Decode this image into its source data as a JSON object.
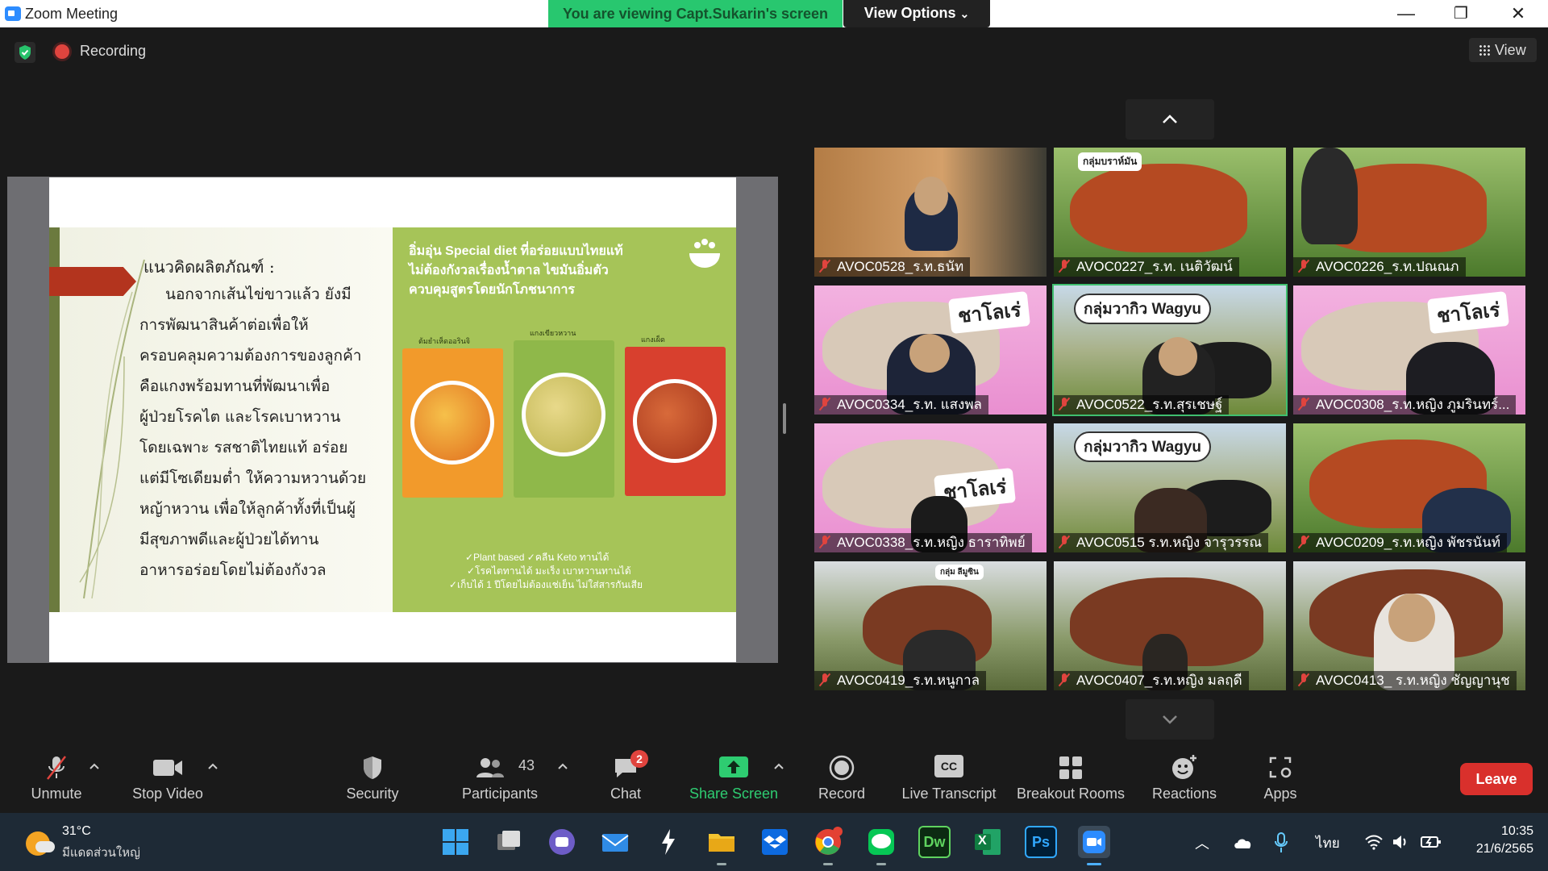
{
  "window": {
    "title": "Zoom Meeting",
    "viewing_banner": "You are viewing Capt.Sukarin's screen",
    "view_options": "View Options",
    "minimize": "—",
    "maximize": "❐",
    "close": "✕"
  },
  "status": {
    "recording_label": "Recording",
    "view_label": "View"
  },
  "slide": {
    "heading": "แนวคิดผลิตภัณฑ์ :",
    "body_lines": [
      "นอกจากเส้นไข่ขาวแล้ว ยังมี",
      "การพัฒนาสินค้าต่อเพื่อให้",
      "ครอบคลุมความต้องการของลูกค้า",
      "คือแกงพร้อมทานที่พัฒนาเพื่อ",
      "ผู้ป่วยโรคไต และโรคเบาหวาน",
      "โดยเฉพาะ รสชาติไทยแท้ อร่อย",
      "แต่มีโซเดียมต่ำ ให้ความหวานด้วย",
      "หญ้าหวาน เพื่อให้ลูกค้าทั้งที่เป็นผู้",
      "มีสุขภาพดีและผู้ป่วยได้ทาน",
      "อาหารอร่อยโดยไม่ต้องกังวล"
    ],
    "promo_title_1": "อิ่มอุ่น Special diet ที่อร่อยแบบไทยแท้",
    "promo_title_2": "ไม่ต้องกังวลเรื่องน้ำตาล ไขมันอิ่มตัว",
    "promo_title_3": "ควบคุมสูตรโดยนักโภชนาการ",
    "packs": [
      "ต้มยำเห็ดออรินจิ",
      "แกงเขียวหวาน",
      "แกงเผ็ด"
    ],
    "features": [
      "✓Plant based  ✓คลีน Keto ทานได้",
      "✓โรคไตทานได้ มะเร็ง เบาหวานทานได้",
      "✓เก็บได้ 1 ปีโดยไม่ต้องแช่เย็น ไม่ใส่สารกันเสีย"
    ]
  },
  "gallery": {
    "tiles": [
      {
        "name": "AVOC0528_ร.ท.ธนัท",
        "sign": ""
      },
      {
        "name": "AVOC0227_ร.ท. เนติวัฒน์",
        "sign": "กลุ่มบราห์มัน"
      },
      {
        "name": "AVOC0226_ร.ท.ปณณภ",
        "sign": ""
      },
      {
        "name": "AVOC0334_ร.ท. แสงพล",
        "sign": "ชาโลเร่"
      },
      {
        "name": "AVOC0522_ร.ท.สุรเชษฐ์",
        "sign": "กลุ่มวากิว Wagyu"
      },
      {
        "name": "AVOC0308_ร.ท.หญิง ภูมรินทร์...",
        "sign": "ชาโลเร่"
      },
      {
        "name": "AVOC0338_ร.ท.หญิง ธาราทิพย์",
        "sign": "ชาโลเร่"
      },
      {
        "name": "AVOC0515 ร.ท.หญิง จารุวรรณ",
        "sign": "กลุ่มวากิว Wagyu"
      },
      {
        "name": "AVOC0209_ร.ท.หญิง พัชรนันท์",
        "sign": ""
      },
      {
        "name": "AVOC0419_ร.ท.หนูกาล",
        "sign": "กลุ่ม ลีมูซิน"
      },
      {
        "name": "AVOC0407_ร.ท.หญิง มลฤดี",
        "sign": ""
      },
      {
        "name": "AVOC0413_ ร.ท.หญิง ชัญญานุช",
        "sign": ""
      }
    ]
  },
  "toolbar": {
    "unmute": "Unmute",
    "stop_video": "Stop Video",
    "security": "Security",
    "participants": "Participants",
    "participant_count": "43",
    "chat": "Chat",
    "chat_badge": "2",
    "share_screen": "Share Screen",
    "record": "Record",
    "live_transcript": "Live Transcript",
    "cc": "CC",
    "breakout_rooms": "Breakout Rooms",
    "reactions": "Reactions",
    "apps": "Apps",
    "leave": "Leave"
  },
  "taskbar": {
    "temperature": "31°C",
    "weather_desc": "มีแดดส่วนใหญ่",
    "language": "ไทย",
    "time": "10:35",
    "date": "21/6/2565",
    "dw_label": "Dw",
    "ps_label": "Ps",
    "xl_label": "X",
    "line_label": "LINE"
  },
  "colors": {
    "share_green": "#28c76f",
    "leave_red": "#d9302c",
    "muted_red": "#e0443e"
  }
}
